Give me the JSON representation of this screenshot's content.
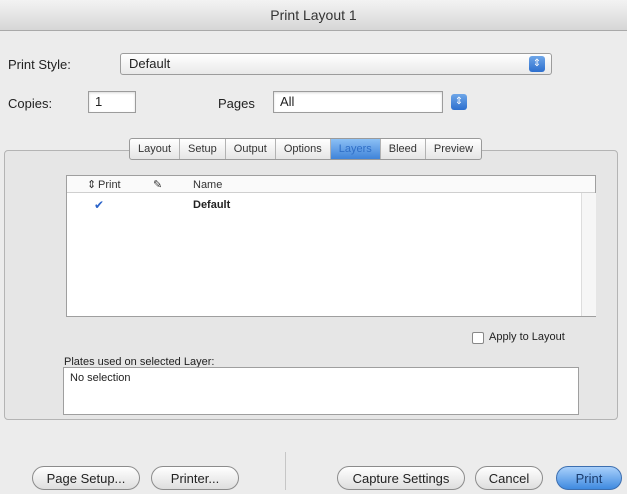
{
  "window": {
    "title": "Print Layout 1"
  },
  "print_style": {
    "label": "Print Style:",
    "value": "Default"
  },
  "copies": {
    "label": "Copies:",
    "value": "1"
  },
  "pages": {
    "label": "Pages",
    "value": "All"
  },
  "tabs": [
    {
      "label": "Layout",
      "selected": false
    },
    {
      "label": "Setup",
      "selected": false
    },
    {
      "label": "Output",
      "selected": false
    },
    {
      "label": "Options",
      "selected": false
    },
    {
      "label": "Layers",
      "selected": true
    },
    {
      "label": "Bleed",
      "selected": false
    },
    {
      "label": "Preview",
      "selected": false
    }
  ],
  "layers_table": {
    "columns": {
      "print": "Print",
      "name": "Name"
    },
    "rows": [
      {
        "checked": true,
        "name": "Default"
      }
    ]
  },
  "apply_to_layout": {
    "label": "Apply to Layout",
    "checked": false
  },
  "plates": {
    "label": "Plates used on selected Layer:",
    "value": "No selection"
  },
  "buttons": {
    "page_setup": "Page Setup...",
    "printer": "Printer...",
    "capture": "Capture Settings",
    "cancel": "Cancel",
    "print": "Print"
  }
}
